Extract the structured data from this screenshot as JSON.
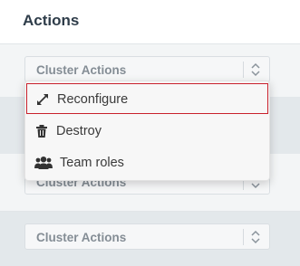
{
  "header": {
    "title": "Actions"
  },
  "cluster_selects": [
    {
      "label": "Cluster Actions"
    },
    {
      "label": "Cluster Actions"
    },
    {
      "label": "Cluster Actions"
    }
  ],
  "dropdown": {
    "items": [
      {
        "label": "Reconfigure",
        "icon": "expand-arrows-icon",
        "selected": true
      },
      {
        "label": "Destroy",
        "icon": "trash-icon",
        "selected": false
      },
      {
        "label": "Team roles",
        "icon": "users-icon",
        "selected": false
      }
    ]
  },
  "colors": {
    "selected_border": "#c8202b",
    "icon_color": "#333333",
    "select_text": "#848d95"
  }
}
